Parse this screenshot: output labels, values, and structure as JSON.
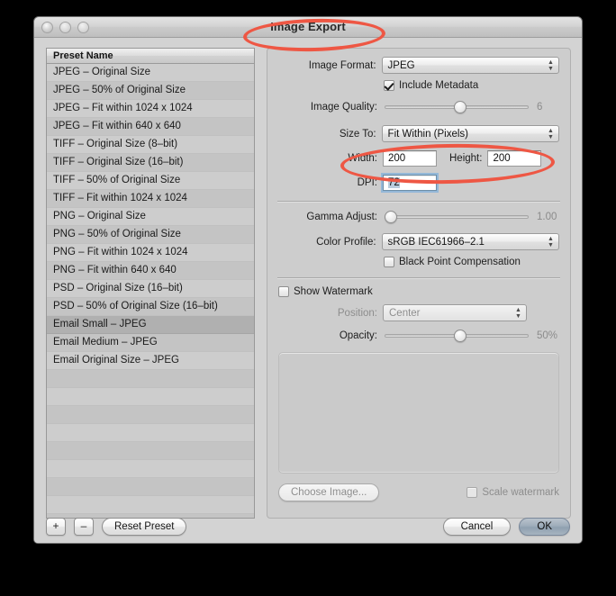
{
  "window": {
    "title": "Image Export",
    "traffic_lights": [
      "close",
      "minimize",
      "zoom"
    ]
  },
  "presets": {
    "header": "Preset Name",
    "selected": "Email Small – JPEG",
    "items": [
      "JPEG – Original Size",
      "JPEG – 50% of Original Size",
      "JPEG – Fit within 1024 x 1024",
      "JPEG – Fit within 640 x 640",
      "TIFF – Original Size (8–bit)",
      "TIFF – Original Size (16–bit)",
      "TIFF – 50% of Original Size",
      "TIFF – Fit within 1024 x 1024",
      "PNG – Original Size",
      "PNG – 50% of Original Size",
      "PNG – Fit within 1024 x 1024",
      "PNG – Fit within 640 x 640",
      "PSD – Original Size (16–bit)",
      "PSD – 50% of Original Size (16–bit)",
      "Email Small – JPEG",
      "Email Medium – JPEG",
      "Email Original Size – JPEG"
    ]
  },
  "settings": {
    "image_format": {
      "label": "Image Format:",
      "value": "JPEG"
    },
    "include_metadata": {
      "label": "Include Metadata",
      "checked": true
    },
    "image_quality": {
      "label": "Image Quality:",
      "value": "6",
      "percent": 52
    },
    "size_to": {
      "label": "Size To:",
      "value": "Fit Within (Pixels)"
    },
    "width": {
      "label": "Width:",
      "value": "200"
    },
    "height": {
      "label": "Height:",
      "value": "200"
    },
    "dpi": {
      "label": "DPI:",
      "value": "72",
      "focused": true
    },
    "gamma_adjust": {
      "label": "Gamma Adjust:",
      "value": "1.00",
      "percent": 0
    },
    "color_profile": {
      "label": "Color Profile:",
      "value": "sRGB IEC61966–2.1"
    },
    "black_point": {
      "label": "Black Point Compensation",
      "checked": false
    },
    "show_watermark": {
      "label": "Show Watermark",
      "checked": false
    },
    "position": {
      "label": "Position:",
      "value": "Center",
      "disabled": true
    },
    "opacity": {
      "label": "Opacity:",
      "value": "50%",
      "percent": 52
    },
    "choose_image": {
      "label": "Choose Image...",
      "disabled": true
    },
    "scale_watermark": {
      "label": "Scale watermark",
      "checked": false,
      "disabled": true
    }
  },
  "footer": {
    "add": "+",
    "remove": "–",
    "reset": "Reset Preset",
    "cancel": "Cancel",
    "ok": "OK"
  },
  "annotations": {
    "color": "#ee5744",
    "marks": [
      "title-ellipse",
      "width-height-ellipse"
    ]
  }
}
